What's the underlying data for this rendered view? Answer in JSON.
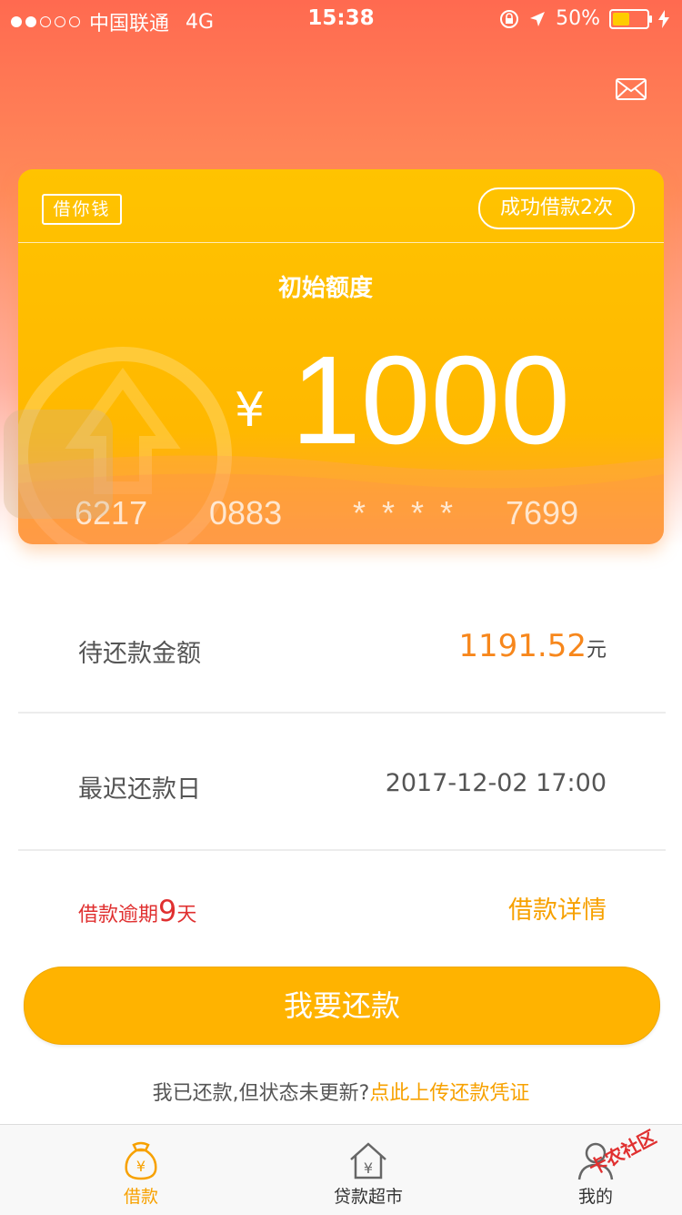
{
  "status_bar": {
    "carrier": "中国联通",
    "network": "4G",
    "time": "15:38",
    "battery": "50%",
    "battery_level": 0.5
  },
  "card": {
    "tag": "借你钱",
    "success_count": "成功借款2次",
    "limit_label": "初始额度",
    "currency": "¥",
    "amount": "1000",
    "card_number": [
      "6217",
      "0883",
      "* * * *",
      "7699"
    ]
  },
  "repay_amount": {
    "label": "待还款金额",
    "value": "1191.52",
    "unit": "元"
  },
  "due_date": {
    "label": "最迟还款日",
    "value": "2017-12-02 17:00"
  },
  "overdue": {
    "prefix": "借款逾期",
    "days": "9",
    "suffix": "天",
    "detail_link": "借款详情"
  },
  "pay_button": "我要还款",
  "hint": {
    "text": "我已还款,但状态未更新?",
    "link": "点此上传还款凭证"
  },
  "tabs": [
    {
      "label": "借款",
      "icon": "money-bag-icon",
      "active": true
    },
    {
      "label": "贷款超市",
      "icon": "house-yen-icon",
      "active": false
    },
    {
      "label": "我的",
      "icon": "user-icon",
      "active": false
    }
  ],
  "watermark": "卡农社区",
  "colors": {
    "accent": "#ffb300",
    "orange_text": "#f7a100",
    "overdue_red": "#e03030"
  }
}
